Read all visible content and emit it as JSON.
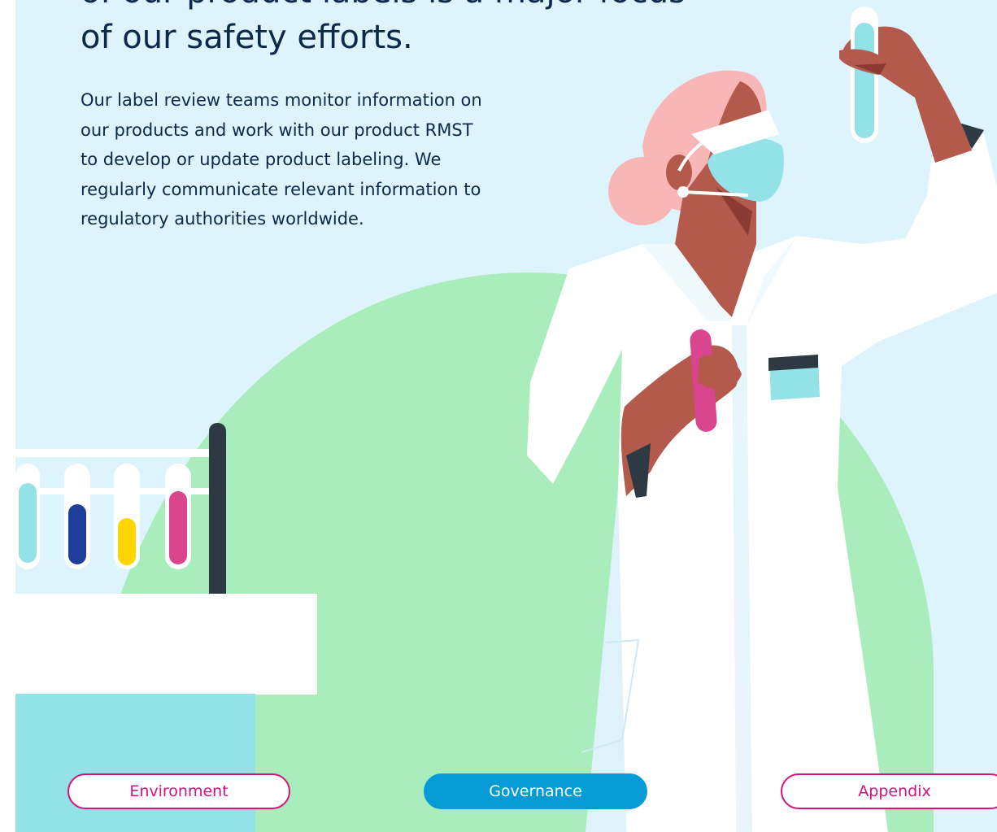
{
  "content": {
    "headline": "of our product labels is a major focus\nof our safety efforts.",
    "body": "Our label review teams monitor information on\nour products and work with our product RMST\nto develop or update product labeling. We\nregularly communicate relevant information to\nregulatory authorities worldwide."
  },
  "nav": {
    "environment_label": "Environment",
    "governance_label": "Governance",
    "appendix_label": "Appendix"
  },
  "illustration": {
    "subject": "scientist-holding-test-tubes",
    "icons": [
      "test-tube-rack",
      "lab-bench",
      "goggles",
      "face-mask",
      "test-tube"
    ]
  },
  "colors": {
    "background": "#def4fd",
    "accent_green": "#a8edbb",
    "accent_pink": "#d6127e",
    "accent_blue": "#079bd6",
    "skin": "#b35a4c",
    "hair": "#f9b6b6",
    "text": "#0b2a4a"
  }
}
